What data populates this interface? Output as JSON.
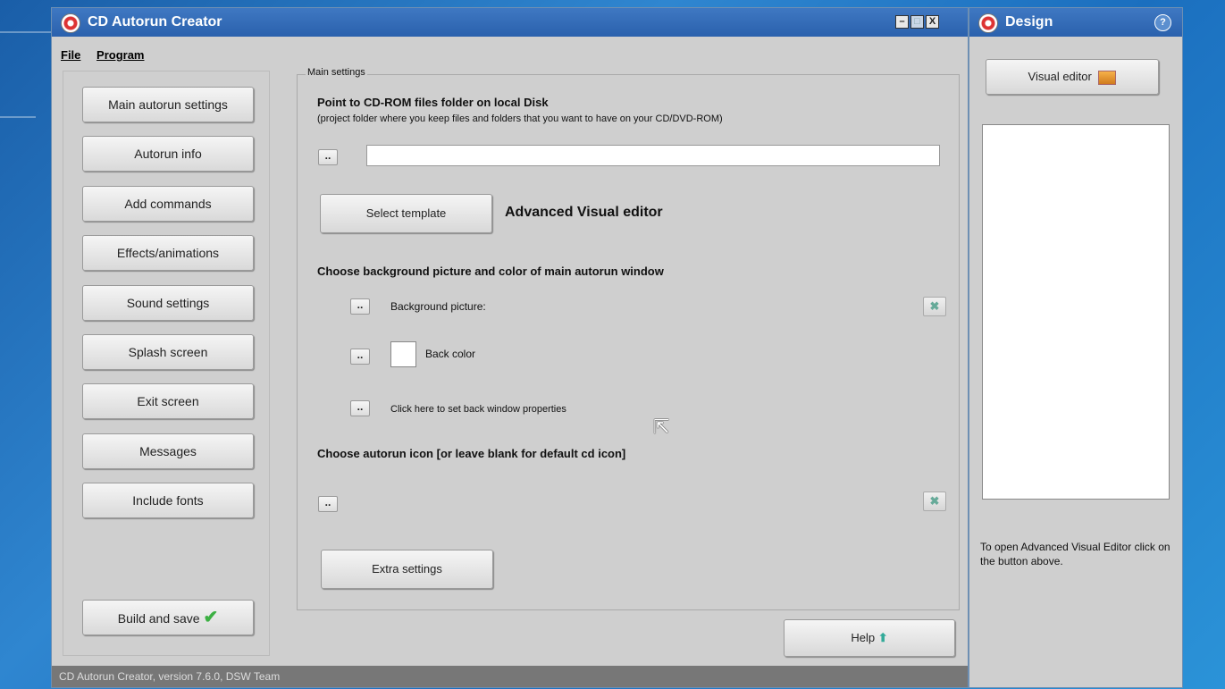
{
  "window": {
    "title": "CD Autorun Creator",
    "controls": [
      "–",
      "□",
      "X"
    ]
  },
  "menu": {
    "file": "File",
    "program": "Program"
  },
  "nav": [
    "Main autorun settings",
    "Autorun info",
    "Add commands",
    "Effects/animations",
    "Sound settings",
    "Splash screen",
    "Exit screen",
    "Messages",
    "Include fonts"
  ],
  "build_button": "Build and save",
  "main": {
    "legend": "Main settings",
    "folder_heading": "Point to CD-ROM files folder on local Disk",
    "folder_note": "(project folder where you keep files and folders that you want to have on your CD/DVD-ROM)",
    "folder_path": "",
    "browse_label": "..",
    "select_template": "Select template",
    "advanced_label": "Advanced Visual editor",
    "background_heading": "Choose background picture and color of main autorun window",
    "bg_picture_label": "Background picture:",
    "back_color_label": "Back color",
    "back_color": "#ffffff",
    "back_window_label": "Click here to set back window properties",
    "icon_heading": "Choose autorun icon [or leave blank for default cd icon]",
    "extra_settings": "Extra settings",
    "help": "Help"
  },
  "status": "CD Autorun Creator, version 7.6.0, DSW Team",
  "design": {
    "title": "Design",
    "visual_editor": "Visual editor",
    "hint": "To open Advanced Visual Editor click on the button above."
  },
  "colors": {
    "titlebar": "#2f67b3",
    "window_bg": "#cfcfcf",
    "check": "#3cb043"
  }
}
